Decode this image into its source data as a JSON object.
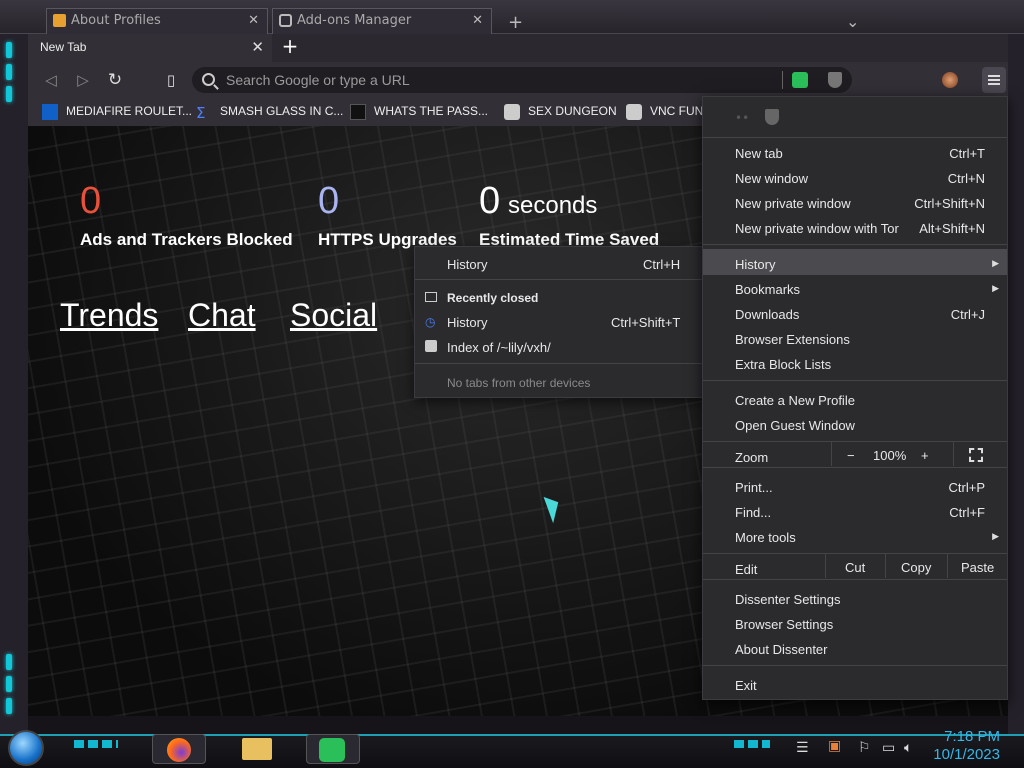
{
  "tabs": {
    "background": [
      "About Profiles",
      "Add-ons Manager"
    ],
    "active": "New Tab",
    "close_glyph": "✕",
    "new_tab_glyph": "+"
  },
  "toolbar": {
    "search_placeholder": "Search Google or type a URL"
  },
  "bookmarks": [
    {
      "label": "MEDIAFIRE ROULET...",
      "icon": "mediafire-icon"
    },
    {
      "label": "SMASH GLASS IN C...",
      "icon": "sigma-icon"
    },
    {
      "label": "WHATS THE PASS...",
      "icon": "person-icon"
    },
    {
      "label": "SEX DUNGEON",
      "icon": "globe-icon"
    },
    {
      "label": "VNC FUN",
      "icon": "globe-icon"
    }
  ],
  "stats": [
    {
      "value": "0",
      "label": "Ads and Trackers Blocked",
      "color": "#e8513a"
    },
    {
      "value": "0",
      "label": "HTTPS Upgrades",
      "color": "#a9b4f0"
    },
    {
      "value": "0",
      "unit": "seconds",
      "label": "Estimated Time Saved",
      "color": "#ffffff"
    }
  ],
  "links": [
    "Trends",
    "Chat",
    "Social"
  ],
  "history_submenu": {
    "history": "History",
    "history_sc": "Ctrl+H",
    "recently_closed": "Recently closed",
    "closed_history": "History",
    "closed_history_sc": "Ctrl+Shift+T",
    "index": "Index of /~lily/vxh/",
    "no_tabs": "No tabs from other devices"
  },
  "menu": {
    "new_tab": "New tab",
    "new_tab_sc": "Ctrl+T",
    "new_window": "New window",
    "new_window_sc": "Ctrl+N",
    "new_private": "New private window",
    "new_private_sc": "Ctrl+Shift+N",
    "new_private_tor": "New private window with Tor",
    "new_private_tor_sc": "Alt+Shift+N",
    "history": "History",
    "bookmarks": "Bookmarks",
    "downloads": "Downloads",
    "downloads_sc": "Ctrl+J",
    "extensions": "Browser Extensions",
    "block_lists": "Extra Block Lists",
    "new_profile": "Create a New Profile",
    "guest": "Open Guest Window",
    "zoom": "Zoom",
    "zoom_minus": "−",
    "zoom_value": "100%",
    "zoom_plus": "+",
    "print": "Print...",
    "print_sc": "Ctrl+P",
    "find": "Find...",
    "find_sc": "Ctrl+F",
    "more_tools": "More tools",
    "edit": "Edit",
    "cut": "Cut",
    "copy": "Copy",
    "paste": "Paste",
    "dissenter_settings": "Dissenter Settings",
    "browser_settings": "Browser Settings",
    "about": "About Dissenter",
    "exit": "Exit"
  },
  "taskbar": {
    "time": "7:18 PM",
    "date": "10/1/2023"
  }
}
